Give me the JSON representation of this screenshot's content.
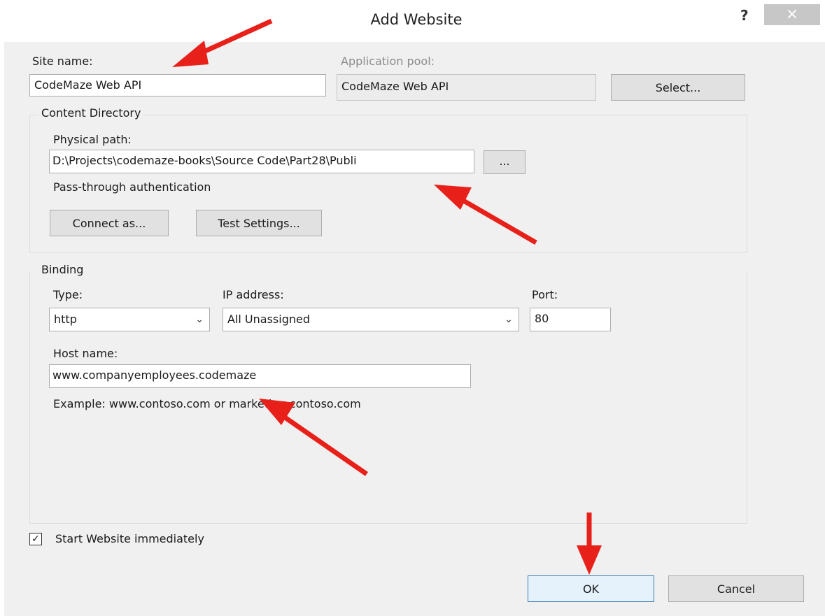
{
  "dialog": {
    "title": "Add Website",
    "help_glyph": "?",
    "close_glyph": "×"
  },
  "site": {
    "site_name_label": "Site name:",
    "site_name_value": "CodeMaze Web API",
    "app_pool_label": "Application pool:",
    "app_pool_value": "CodeMaze Web API",
    "select_button": "Select..."
  },
  "content_directory": {
    "group_title": "Content Directory",
    "physical_path_label": "Physical path:",
    "physical_path_value": "D:\\Projects\\codemaze-books\\Source Code\\Part28\\Publi",
    "browse_button": "...",
    "pass_through_label": "Pass-through authentication",
    "connect_as_button": "Connect as...",
    "test_settings_button": "Test Settings..."
  },
  "binding": {
    "group_title": "Binding",
    "type_label": "Type:",
    "type_value": "http",
    "ip_label": "IP address:",
    "ip_value": "All Unassigned",
    "port_label": "Port:",
    "port_value": "80",
    "host_label": "Host name:",
    "host_value": "www.companyemployees.codemaze",
    "example_text": "Example: www.contoso.com or marketing.contoso.com"
  },
  "start_immediately": {
    "label": "Start Website immediately",
    "checked": true
  },
  "footer": {
    "ok_button": "OK",
    "cancel_button": "Cancel"
  },
  "colors": {
    "annotation_arrow": "#e8201a",
    "dialog_background": "#f0f0f0",
    "default_button_border": "#3c7fb1"
  }
}
